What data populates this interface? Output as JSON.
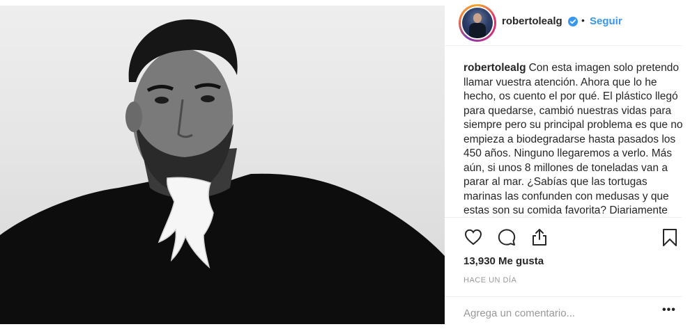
{
  "post": {
    "author": {
      "username": "robertolealg",
      "verified": true,
      "follow_label": "Seguir",
      "separator": "•"
    },
    "caption": {
      "username": "robertolealg",
      "text": "Con esta imagen solo pretendo llamar vuestra atención. Ahora que lo he hecho, os cuento el por qué. El plástico llegó para quedarse, cambió nuestras vidas para siempre pero su principal problema es que no empieza a biodegradarse hasta pasados los 450 años. Ninguno llegaremos a verlo. Más aún, si unos 8 millones de toneladas van a parar al mar. ¿Sabías que las tortugas marinas las confunden con medusas y que estas son su comida favorita? Diariamente mueren"
    },
    "actions": {
      "like_icon": "heart-icon",
      "comment_icon": "comment-icon",
      "share_icon": "share-icon",
      "save_icon": "bookmark-icon"
    },
    "likes_label": "13,930 Me gusta",
    "time_ago": "HACE UN DÍA",
    "comment": {
      "placeholder": "Agrega un comentario...",
      "more_label": "•••"
    }
  },
  "colors": {
    "link_blue": "#3897f0",
    "text": "#262626",
    "muted": "#999999",
    "divider": "#efefef"
  }
}
